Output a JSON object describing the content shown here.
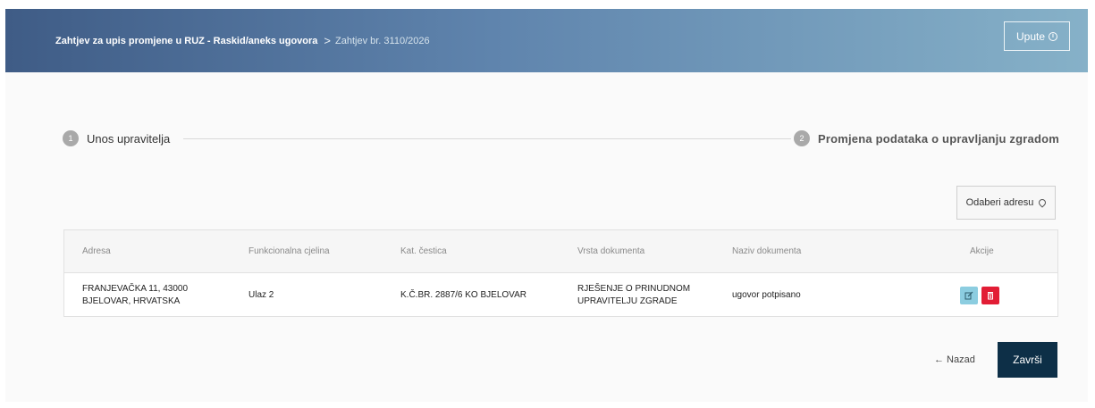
{
  "header": {
    "breadcrumb_current": "Zahtjev za upis promjene u RUZ - Raskid/aneks ugovora",
    "breadcrumb_separator": ">",
    "breadcrumb_sub": "Zahtjev br. 3110/2026",
    "help_button": "Upute"
  },
  "stepper": {
    "steps": [
      {
        "number": "1",
        "label": "Unos upravitelja"
      },
      {
        "number": "2",
        "label": "Promjena podataka o upravljanju zgradom"
      }
    ]
  },
  "address_button": "Odaberi adresu",
  "table": {
    "columns": [
      "Adresa",
      "Funkcionalna cjelina",
      "Kat. čestica",
      "Vrsta dokumenta",
      "Naziv dokumenta",
      "Akcije"
    ],
    "rows": [
      {
        "address_line1": "FRANJEVAČKA 11, 43000",
        "address_line2": "BJELOVAR, HRVATSKA",
        "unit": "Ulaz 2",
        "parcel": "K.Č.BR. 2887/6 KO BJELOVAR",
        "doc_type_line1": "RJEŠENJE O PRINUDNOM",
        "doc_type_line2": "UPRAVITELJU ZGRADE",
        "doc_name": "ugovor potpisano"
      }
    ]
  },
  "footer": {
    "back_label": "← Nazad",
    "finish_label": "Završi"
  },
  "colors": {
    "header_start": "#3f5c86",
    "header_end": "#86b1c8",
    "edit_button": "#8ccde0",
    "delete_button": "#e21d35",
    "primary_button": "#0d2f47"
  },
  "icons": {
    "help": "info-circle-icon",
    "address": "map-pin-icon",
    "edit": "edit-icon",
    "delete": "trash-icon"
  }
}
